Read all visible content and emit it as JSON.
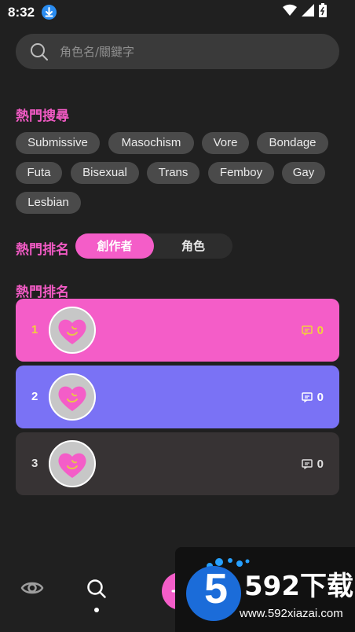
{
  "status_bar": {
    "time": "8:32",
    "icons": [
      "download-icon",
      "wifi-icon",
      "signal-icon",
      "battery-icon"
    ]
  },
  "search": {
    "placeholder": "角色名/關鍵字",
    "value": ""
  },
  "hot_search": {
    "title": "熱門搜尋",
    "tags": [
      "Submissive",
      "Masochism",
      "Vore",
      "Bondage",
      "Futa",
      "Bisexual",
      "Trans",
      "Femboy",
      "Gay",
      "Lesbian"
    ]
  },
  "hot_ranking": {
    "title": "熱門排名",
    "toggle": {
      "options": [
        "創作者",
        "角色"
      ],
      "selected": "創作者"
    }
  },
  "ranking_list": {
    "title": "熱門排名",
    "items": [
      {
        "rank": "1",
        "comments": "0",
        "color": "#f45dc8",
        "text_color": "#f2d23a"
      },
      {
        "rank": "2",
        "comments": "0",
        "color": "#7a72f5",
        "text_color": "#ffffff"
      },
      {
        "rank": "3",
        "comments": "0",
        "color": "#373334",
        "text_color": "#e0e0e0"
      }
    ]
  },
  "bottom_nav": {
    "items": [
      "eye-icon",
      "search-icon",
      "add-icon"
    ],
    "active": "search-icon"
  },
  "watermark": {
    "brand": "592下载",
    "logo_digit": "5",
    "url": "www.592xiazai.com"
  },
  "colors": {
    "accent": "#f45dc8",
    "background": "#202020",
    "tag_bg": "#4a4a4a"
  }
}
